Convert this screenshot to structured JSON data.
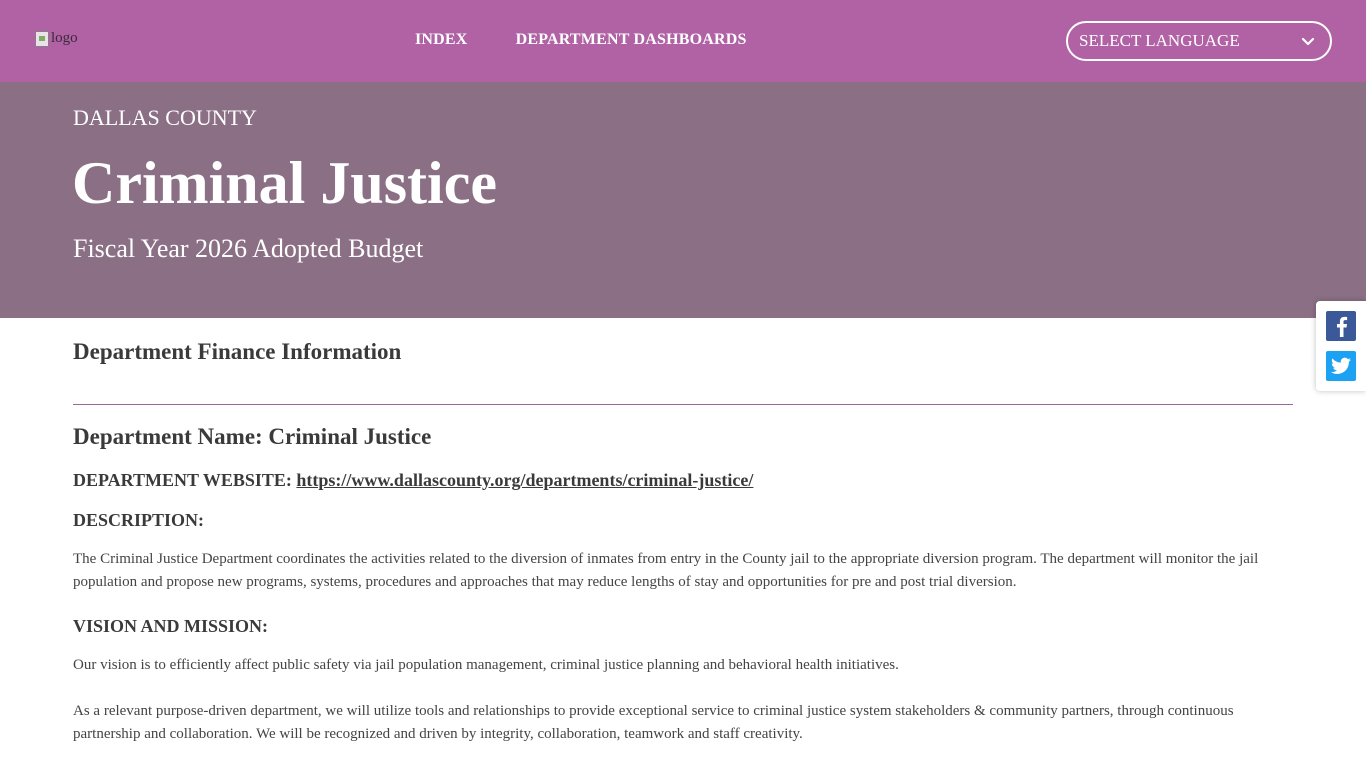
{
  "header": {
    "logo_alt": "logo",
    "nav": [
      "INDEX",
      "DEPARTMENT DASHBOARDS"
    ],
    "language_select": "SELECT LANGUAGE"
  },
  "hero": {
    "county": "DALLAS COUNTY",
    "title": "Criminal Justice",
    "subtitle": "Fiscal Year 2026 Adopted Budget"
  },
  "share": {
    "icons": [
      "facebook-icon",
      "twitter-icon"
    ]
  },
  "content": {
    "section_title": "Department Finance Information",
    "department_name": "Department Name: Criminal Justice",
    "website_label": "DEPARTMENT WEBSITE:",
    "website_url": "https://www.dallascounty.org/departments/criminal-justice/",
    "description_label": "DESCRIPTION:",
    "description": "The Criminal Justice Department coordinates the activities related to the diversion of inmates from entry in the County jail to the appropriate diversion program. The department will monitor the jail population and propose new programs, systems, procedures and approaches that may reduce lengths of stay and opportunities for pre and post trial diversion.",
    "vision_label": "VISION AND MISSION:",
    "vision": "Our vision is to efficiently affect public safety via jail population management, criminal justice planning and behavioral health initiatives.",
    "mission": "As a relevant purpose-driven department, we will utilize tools and relationships to provide exceptional service to criminal justice system stakeholders & community partners, through continuous partnership and collaboration. We will be recognized and driven by integrity, collaboration, teamwork and staff creativity."
  },
  "colors": {
    "topbar": "#b062a4",
    "hero": "#8b7085",
    "divider": "#9a6a94",
    "facebook": "#3b5998",
    "twitter": "#1da1f2"
  }
}
